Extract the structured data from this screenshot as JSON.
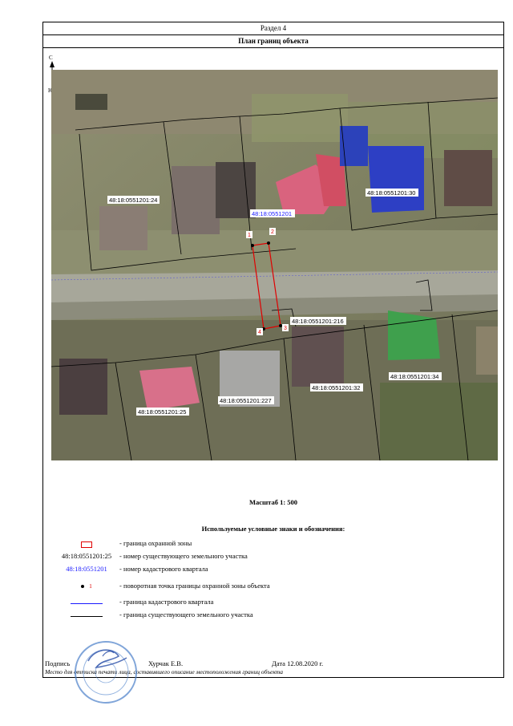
{
  "header": {
    "section": "Раздел 4",
    "title": "План границ объекта"
  },
  "north_arrow": {
    "top_letter": "С",
    "bottom_letter": "Ю"
  },
  "map": {
    "parcels": [
      "48:18:0551201:24",
      "48:18:0551201:30",
      "48:18:0551201:216",
      "48:18:0551201:34",
      "48:18:0551201:227",
      "48:18:0551201:32",
      "48:18:0551201:25"
    ],
    "quarter": "48:18:0551201",
    "points": [
      "1",
      "2",
      "3",
      "4"
    ],
    "zone_color": "#e00000",
    "quarter_color": "#1a1aff"
  },
  "scale": "Масштаб 1: 500",
  "legend": {
    "title": "Используемые условные знаки и обозначения:",
    "items": [
      {
        "symbol": "",
        "text": "- граница  охранной зоны"
      },
      {
        "symbol": "48:18:0551201:25",
        "text": "- номер существующего земельного участка"
      },
      {
        "symbol": "48:18:0551201",
        "text": "- номер кадастрового квартала"
      },
      {
        "symbol": "1",
        "text": "- поворотная точка границы охранной зоны объекта"
      },
      {
        "symbol": "",
        "text": "- граница кадастрового квартала"
      },
      {
        "symbol": "",
        "text": "- граница существующего земельного участка"
      }
    ]
  },
  "signature": {
    "label": "Подпись",
    "name": "Хурчак Е.В.",
    "date": "Дата 12.08.2020 г.",
    "note": "Место для оттиска печати лица, составившего описание местоположения границ объекта"
  }
}
